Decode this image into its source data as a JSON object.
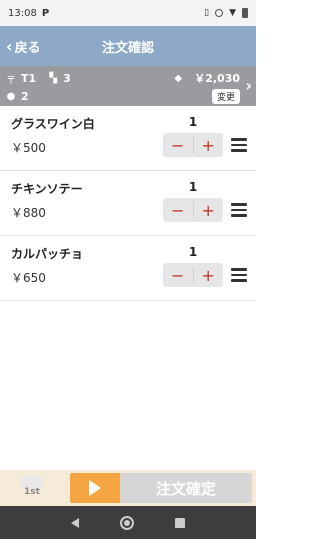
{
  "status_bar": {
    "time": "13:08",
    "app_letter": "P"
  },
  "header": {
    "back_label": "戻る",
    "title": "注文確認"
  },
  "info": {
    "table": "T1",
    "items_count": "3",
    "guests": "2",
    "total": "￥2,030",
    "change_label": "変更"
  },
  "items": [
    {
      "name": "グラスワイン白",
      "price": "￥500",
      "qty": "1"
    },
    {
      "name": "チキンソテー",
      "price": "￥880",
      "qty": "1"
    },
    {
      "name": "カルパッチョ",
      "price": "￥650",
      "qty": "1"
    }
  ],
  "footer": {
    "chef_label": "1st",
    "confirm_label": "注文確定"
  },
  "colors": {
    "header": "#8ea8c8",
    "info_bar": "#999b9e",
    "accent": "#f5a642",
    "stepper_sign": "#c0392b"
  }
}
